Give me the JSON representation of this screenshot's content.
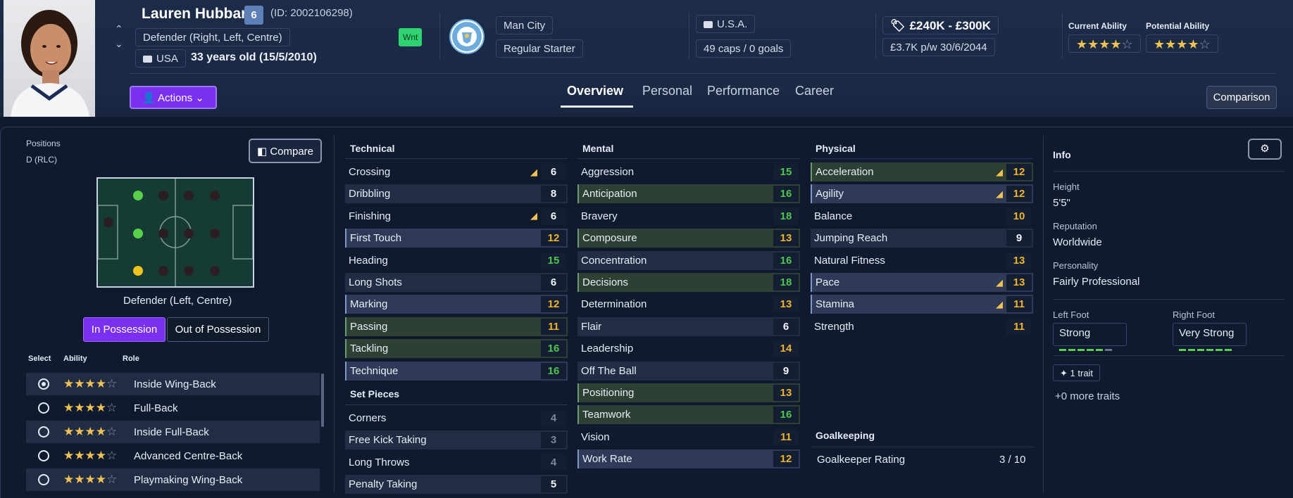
{
  "player": {
    "name": "Lauren Hubbard",
    "number": "6",
    "id": "(ID: 2002106298)",
    "position": "Defender (Right, Left, Centre)",
    "nation_code": "USA",
    "age": "33 years old (15/5/2010)",
    "squad_tag": "Wnt",
    "club": "Man City",
    "club_logo_text": "MANCHESTER CITY",
    "squad_status": "Regular Starter",
    "intl_nation": "U.S.A.",
    "caps": "49 caps / 0 goals",
    "value": "£240K - £300K",
    "wage_label": "£3.7K p/w",
    "contract": "30/6/2044",
    "current_ability_label": "Current Ability",
    "potential_ability_label": "Potential Ability",
    "current_ability_stars": 4,
    "potential_ability_stars": 4
  },
  "actions_label": "Actions",
  "tabs": [
    "Overview",
    "Personal",
    "Performance",
    "Career"
  ],
  "active_tab": "Overview",
  "comparison_label": "Comparison",
  "positions": {
    "label": "Positions",
    "value": "D (RLC)",
    "compare_label": "Compare",
    "pitch_caption": "Defender (Left, Centre)",
    "toggle_on": "In Possession",
    "toggle_off": "Out of Possession",
    "headers": [
      "Select",
      "Ability",
      "Role"
    ],
    "roles": [
      {
        "name": "Inside Wing-Back",
        "stars": 4,
        "selected": true
      },
      {
        "name": "Full-Back",
        "stars": 4,
        "selected": false
      },
      {
        "name": "Inside Full-Back",
        "stars": 4,
        "selected": false
      },
      {
        "name": "Advanced Centre-Back",
        "stars": 4,
        "selected": false
      },
      {
        "name": "Playmaking Wing-Back",
        "stars": 4,
        "selected": false
      }
    ]
  },
  "technical": {
    "title": "Technical",
    "rows": [
      {
        "name": "Crossing",
        "value": "6",
        "trend": true,
        "style": "",
        "color": "w"
      },
      {
        "name": "Dribbling",
        "value": "8",
        "trend": false,
        "style": "alt",
        "color": "w"
      },
      {
        "name": "Finishing",
        "value": "6",
        "trend": true,
        "style": "",
        "color": "w"
      },
      {
        "name": "First Touch",
        "value": "12",
        "trend": false,
        "style": "hl",
        "color": "y"
      },
      {
        "name": "Heading",
        "value": "15",
        "trend": false,
        "style": "",
        "color": "g"
      },
      {
        "name": "Long Shots",
        "value": "6",
        "trend": false,
        "style": "alt",
        "color": "w"
      },
      {
        "name": "Marking",
        "value": "12",
        "trend": false,
        "style": "hl",
        "color": "y"
      },
      {
        "name": "Passing",
        "value": "11",
        "trend": false,
        "style": "gr",
        "color": "y"
      },
      {
        "name": "Tackling",
        "value": "16",
        "trend": false,
        "style": "gr",
        "color": "g"
      },
      {
        "name": "Technique",
        "value": "16",
        "trend": false,
        "style": "hl",
        "color": "g"
      }
    ]
  },
  "set_pieces": {
    "title": "Set Pieces",
    "rows": [
      {
        "name": "Corners",
        "value": "4",
        "trend": false,
        "style": "",
        "color": "d"
      },
      {
        "name": "Free Kick Taking",
        "value": "3",
        "trend": false,
        "style": "alt",
        "color": "d"
      },
      {
        "name": "Long Throws",
        "value": "4",
        "trend": false,
        "style": "",
        "color": "d"
      },
      {
        "name": "Penalty Taking",
        "value": "5",
        "trend": false,
        "style": "alt",
        "color": "w"
      }
    ]
  },
  "mental": {
    "title": "Mental",
    "rows": [
      {
        "name": "Aggression",
        "value": "15",
        "trend": false,
        "style": "",
        "color": "g"
      },
      {
        "name": "Anticipation",
        "value": "16",
        "trend": false,
        "style": "gr",
        "color": "g"
      },
      {
        "name": "Bravery",
        "value": "18",
        "trend": false,
        "style": "",
        "color": "g"
      },
      {
        "name": "Composure",
        "value": "13",
        "trend": false,
        "style": "gr",
        "color": "y"
      },
      {
        "name": "Concentration",
        "value": "16",
        "trend": false,
        "style": "alt",
        "color": "g"
      },
      {
        "name": "Decisions",
        "value": "18",
        "trend": false,
        "style": "gr",
        "color": "g"
      },
      {
        "name": "Determination",
        "value": "13",
        "trend": false,
        "style": "",
        "color": "y"
      },
      {
        "name": "Flair",
        "value": "6",
        "trend": false,
        "style": "alt",
        "color": "w"
      },
      {
        "name": "Leadership",
        "value": "14",
        "trend": false,
        "style": "",
        "color": "y"
      },
      {
        "name": "Off The Ball",
        "value": "9",
        "trend": false,
        "style": "alt",
        "color": "w"
      },
      {
        "name": "Positioning",
        "value": "13",
        "trend": false,
        "style": "gr",
        "color": "y"
      },
      {
        "name": "Teamwork",
        "value": "16",
        "trend": false,
        "style": "gr",
        "color": "g"
      },
      {
        "name": "Vision",
        "value": "11",
        "trend": false,
        "style": "",
        "color": "y"
      },
      {
        "name": "Work Rate",
        "value": "12",
        "trend": false,
        "style": "hl",
        "color": "y"
      }
    ]
  },
  "physical": {
    "title": "Physical",
    "rows": [
      {
        "name": "Acceleration",
        "value": "12",
        "trend": true,
        "style": "gr",
        "color": "y"
      },
      {
        "name": "Agility",
        "value": "12",
        "trend": true,
        "style": "hl",
        "color": "y"
      },
      {
        "name": "Balance",
        "value": "10",
        "trend": false,
        "style": "",
        "color": "y"
      },
      {
        "name": "Jumping Reach",
        "value": "9",
        "trend": false,
        "style": "alt",
        "color": "w"
      },
      {
        "name": "Natural Fitness",
        "value": "13",
        "trend": false,
        "style": "",
        "color": "y"
      },
      {
        "name": "Pace",
        "value": "13",
        "trend": true,
        "style": "hl",
        "color": "y"
      },
      {
        "name": "Stamina",
        "value": "11",
        "trend": true,
        "style": "hl",
        "color": "y"
      },
      {
        "name": "Strength",
        "value": "11",
        "trend": false,
        "style": "",
        "color": "y"
      }
    ]
  },
  "goalkeeping": {
    "title": "Goalkeeping",
    "label": "Goalkeeper Rating",
    "value": "3 / 10"
  },
  "info": {
    "title": "Info",
    "height_label": "Height",
    "height": "5'5\"",
    "reputation_label": "Reputation",
    "reputation": "Worldwide",
    "personality_label": "Personality",
    "personality": "Fairly Professional",
    "left_foot_label": "Left Foot",
    "left_foot": "Strong",
    "left_foot_level": 0.8,
    "right_foot_label": "Right Foot",
    "right_foot": "Very Strong",
    "right_foot_level": 1.0,
    "traits_label": "1 trait",
    "more_traits": "+0 more traits"
  },
  "colors": {
    "accent_purple": "#7b2ff0",
    "green": "#4cc64c",
    "yellow": "#f0b428",
    "wnt_badge": "#2fd36f"
  }
}
